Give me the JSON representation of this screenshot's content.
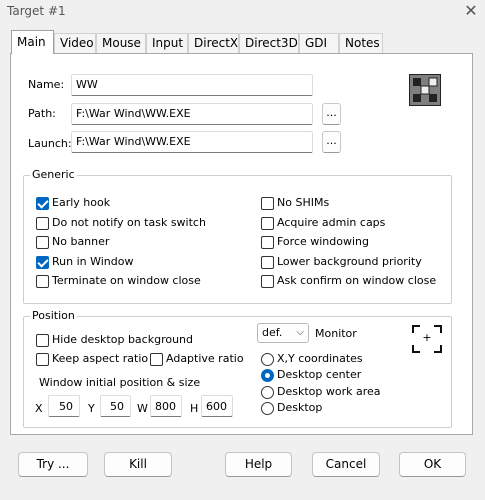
{
  "window": {
    "title": "Target #1",
    "close_glyph": "✕"
  },
  "tabs": [
    "Main",
    "Video",
    "Mouse",
    "Input",
    "DirectX",
    "Direct3D",
    "GDI",
    "Notes"
  ],
  "active_tab": "Main",
  "fields": {
    "name_label": "Name:",
    "name_value": "WW",
    "path_label": "Path:",
    "path_value": "F:\\War Wind\\WW.EXE",
    "launch_label": "Launch:",
    "launch_value": "F:\\War Wind\\WW.EXE",
    "browse_label": "..."
  },
  "app_icon": "app-icon",
  "generic": {
    "title": "Generic",
    "left": [
      {
        "label": "Early hook",
        "checked": true
      },
      {
        "label": "Do not notify on task switch",
        "checked": false
      },
      {
        "label": "No banner",
        "checked": false
      },
      {
        "label": "Run in Window",
        "checked": true
      },
      {
        "label": "Terminate on window close",
        "checked": false
      }
    ],
    "right": [
      {
        "label": "No SHIMs",
        "checked": false
      },
      {
        "label": "Acquire admin caps",
        "checked": false
      },
      {
        "label": "Force windowing",
        "checked": false
      },
      {
        "label": "Lower background priority",
        "checked": false
      },
      {
        "label": "Ask confirm on window close",
        "checked": false
      }
    ]
  },
  "position": {
    "title": "Position",
    "hide_desktop": {
      "label": "Hide desktop background",
      "checked": false
    },
    "keep_aspect": {
      "label": "Keep aspect ratio",
      "checked": false
    },
    "adaptive": {
      "label": "Adaptive ratio",
      "checked": false
    },
    "monitor_value": "def.",
    "monitor_label": "Monitor",
    "initial_label": "Window initial position & size",
    "x_label": "X",
    "x_value": "50",
    "y_label": "Y",
    "y_value": "50",
    "w_label": "W",
    "w_value": "800",
    "h_label": "H",
    "h_value": "600",
    "radios": [
      {
        "label": "X,Y coordinates",
        "selected": false
      },
      {
        "label": "Desktop center",
        "selected": true
      },
      {
        "label": "Desktop work area",
        "selected": false
      },
      {
        "label": "Desktop",
        "selected": false
      }
    ],
    "target_glyph": "+"
  },
  "buttons": {
    "try": "Try ...",
    "kill": "Kill",
    "help": "Help",
    "cancel": "Cancel",
    "ok": "OK"
  },
  "colors": {
    "accent": "#0067c0",
    "background": "#f0f0f0"
  }
}
